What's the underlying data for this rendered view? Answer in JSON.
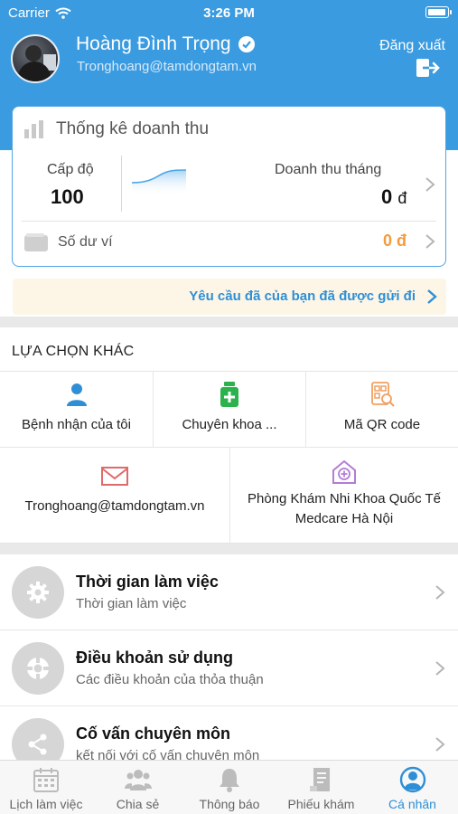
{
  "status_bar": {
    "carrier": "Carrier",
    "time": "3:26 PM"
  },
  "profile": {
    "name": "Hoàng Đình Trọng",
    "email": "Tronghoang@tamdongtam.vn",
    "logout_label": "Đăng xuất"
  },
  "stats": {
    "title": "Thống kê doanh thu",
    "level_label": "Cấp độ",
    "level_value": "100",
    "revenue_label": "Doanh thu tháng",
    "revenue_value": "0",
    "revenue_currency": "đ",
    "wallet_label": "Số dư ví",
    "wallet_value": "0 đ"
  },
  "notice": {
    "text": "Yêu cầu đã của bạn đã được gửi đi"
  },
  "other_options": {
    "title": "LỰA CHỌN KHÁC",
    "items": [
      {
        "label": "Bệnh nhận của tôi",
        "icon": "person-icon"
      },
      {
        "label": "Chuyên khoa ...",
        "icon": "medicine-bottle-icon"
      },
      {
        "label": "Mã QR code",
        "icon": "qr-code-icon"
      },
      {
        "label": "Tronghoang@tamdongtam.vn",
        "icon": "mail-icon"
      },
      {
        "label": "Phòng Khám Nhi Khoa Quốc Tế Medcare Hà Nội",
        "icon": "clinic-icon"
      }
    ]
  },
  "menu": [
    {
      "title": "Thời gian làm việc",
      "subtitle": "Thời gian làm việc",
      "icon": "gear-icon"
    },
    {
      "title": "Điều khoản sử dụng",
      "subtitle": "Các điều khoản của thỏa thuận",
      "icon": "terms-icon"
    },
    {
      "title": "Cố vấn chuyên môn",
      "subtitle": "kết nối với cố vấn chuyên môn",
      "icon": "share-icon"
    }
  ],
  "tabs": [
    {
      "label": "Lịch làm việc",
      "icon": "calendar-icon",
      "active": false
    },
    {
      "label": "Chia sẻ",
      "icon": "group-icon",
      "active": false
    },
    {
      "label": "Thông báo",
      "icon": "bell-icon",
      "active": false
    },
    {
      "label": "Phiếu khám",
      "icon": "document-icon",
      "active": false
    },
    {
      "label": "Cá nhân",
      "icon": "user-circle-icon",
      "active": true
    }
  ],
  "colors": {
    "header": "#3a9be0",
    "accent": "#2e8fd6",
    "wallet": "#f29b3f",
    "notice_bg": "#fdf6e7"
  }
}
